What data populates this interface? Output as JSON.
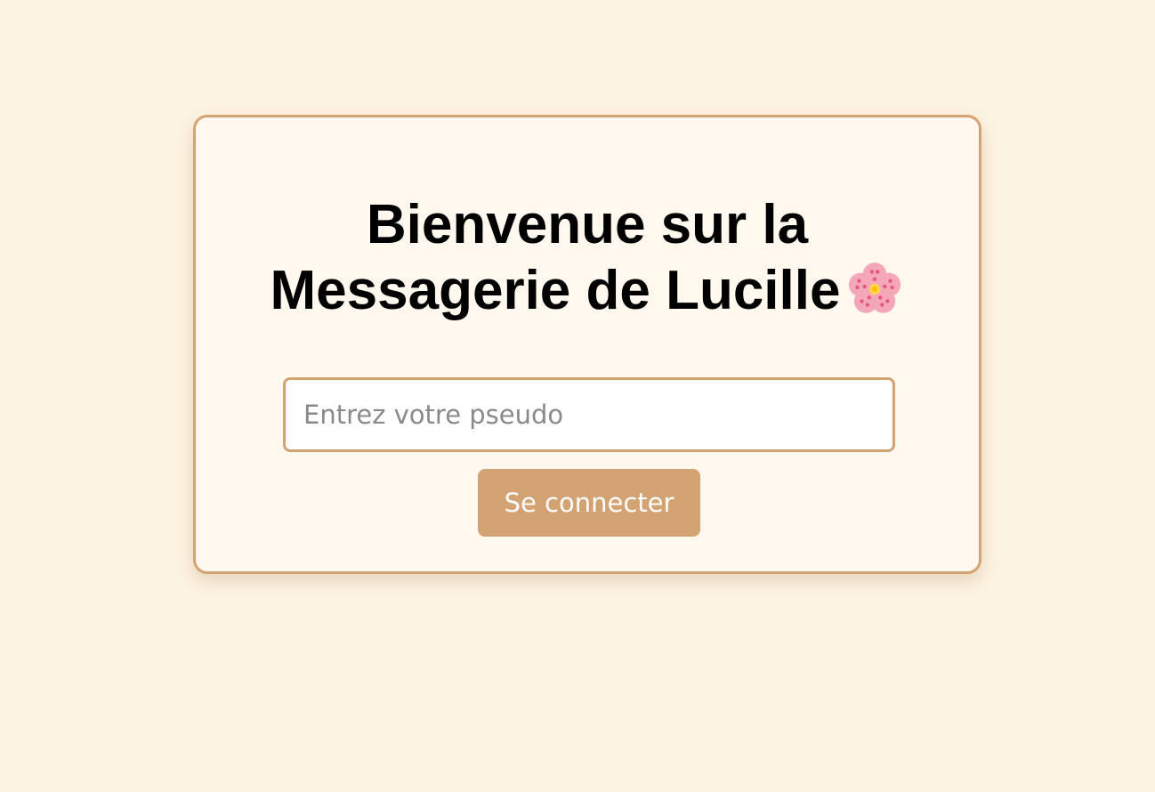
{
  "login": {
    "title_line1": "Bienvenue sur la",
    "title_line2": "Messagerie de Lucille",
    "title_icon": "cherry-blossom-icon",
    "pseudo_placeholder": "Entrez votre pseudo",
    "pseudo_value": "",
    "connect_label": "Se connecter"
  },
  "colors": {
    "background": "#fdf3e1",
    "card_background": "#fff8ee",
    "accent": "#d4a373",
    "button_text": "#ffffff"
  }
}
